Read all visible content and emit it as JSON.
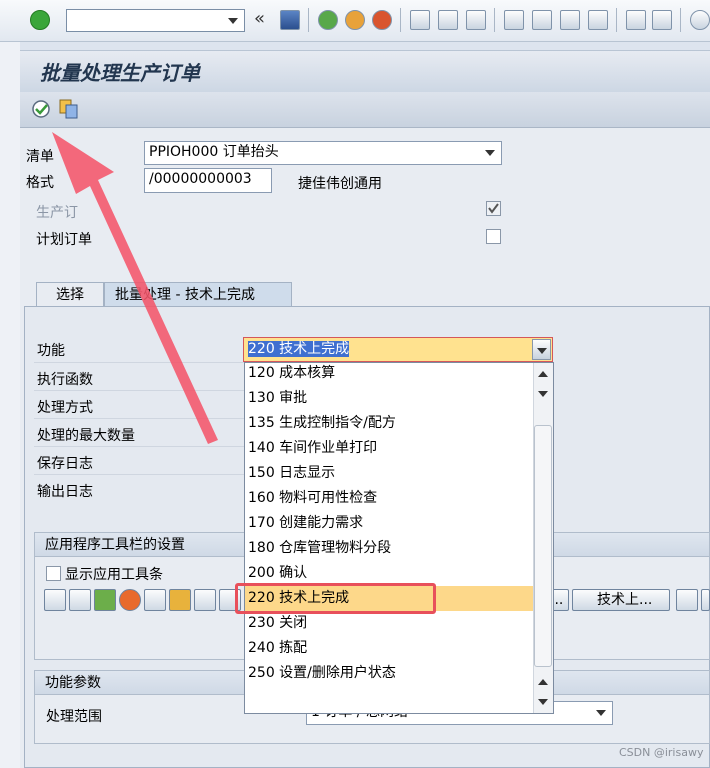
{
  "toolbar": {
    "command_field_value": "",
    "icons": [
      "enter-icon",
      "back-icon",
      "save-icon",
      "exit-icon",
      "cancel-icon",
      "print-icon",
      "find-icon",
      "find-next-icon",
      "first-page-icon",
      "prev-page-icon",
      "next-page-icon",
      "last-page-icon",
      "create-session-icon",
      "shortcut-icon",
      "help-icon"
    ]
  },
  "title": "批量处理生产订单",
  "app_toolbar": {
    "icons": [
      "execute-icon",
      "copy-icon"
    ]
  },
  "header": {
    "list_label": "清单",
    "list_value": "PPIOH000 订单抬头",
    "format_label": "格式",
    "format_value": "/00000000003",
    "format_desc": "捷佳伟创通用",
    "prod_order_label": "生产订",
    "prod_order_checked": true,
    "planned_order_label": "计划订单",
    "planned_order_checked": false
  },
  "tabs": [
    {
      "label": "选择"
    },
    {
      "label": "批量处理 - 技术上完成"
    }
  ],
  "fields": {
    "function_label": "功能",
    "exec_label": "执行函数",
    "mode_label": "处理方式",
    "max_label": "处理的最大数量",
    "log_label": "保存日志",
    "output_label": "输出日志"
  },
  "function_select": {
    "selected": "220 技术上完成"
  },
  "dropdown_options": [
    "120 成本核算",
    "130 审批",
    "135 生成控制指令/配方",
    "140 车间作业单打印",
    "150 日志显示",
    "160 物料可用性检查",
    "170 创建能力需求",
    "180 仓库管理物料分段",
    "200 确认",
    "220 技术上完成",
    "230 关闭",
    "240 拣配",
    "250 设置/删除用户状态"
  ],
  "highlighted_option": "220 技术上完成",
  "app_toolbar_settings": {
    "title": "应用程序工具栏的设置",
    "show_toolbar_label": "显示应用工具条",
    "show_toolbar_checked": false,
    "btn_partial": "...",
    "btn_tech_label": "技术上..."
  },
  "func_params": {
    "title": "功能参数",
    "range_label": "处理范围",
    "range_value": "1 订单 / 总网络"
  },
  "watermark": "CSDN @irisawy",
  "colors": {
    "accent_red": "#e8505b",
    "highlight": "#fdd88a",
    "selection_blue": "#3f6fd0"
  }
}
